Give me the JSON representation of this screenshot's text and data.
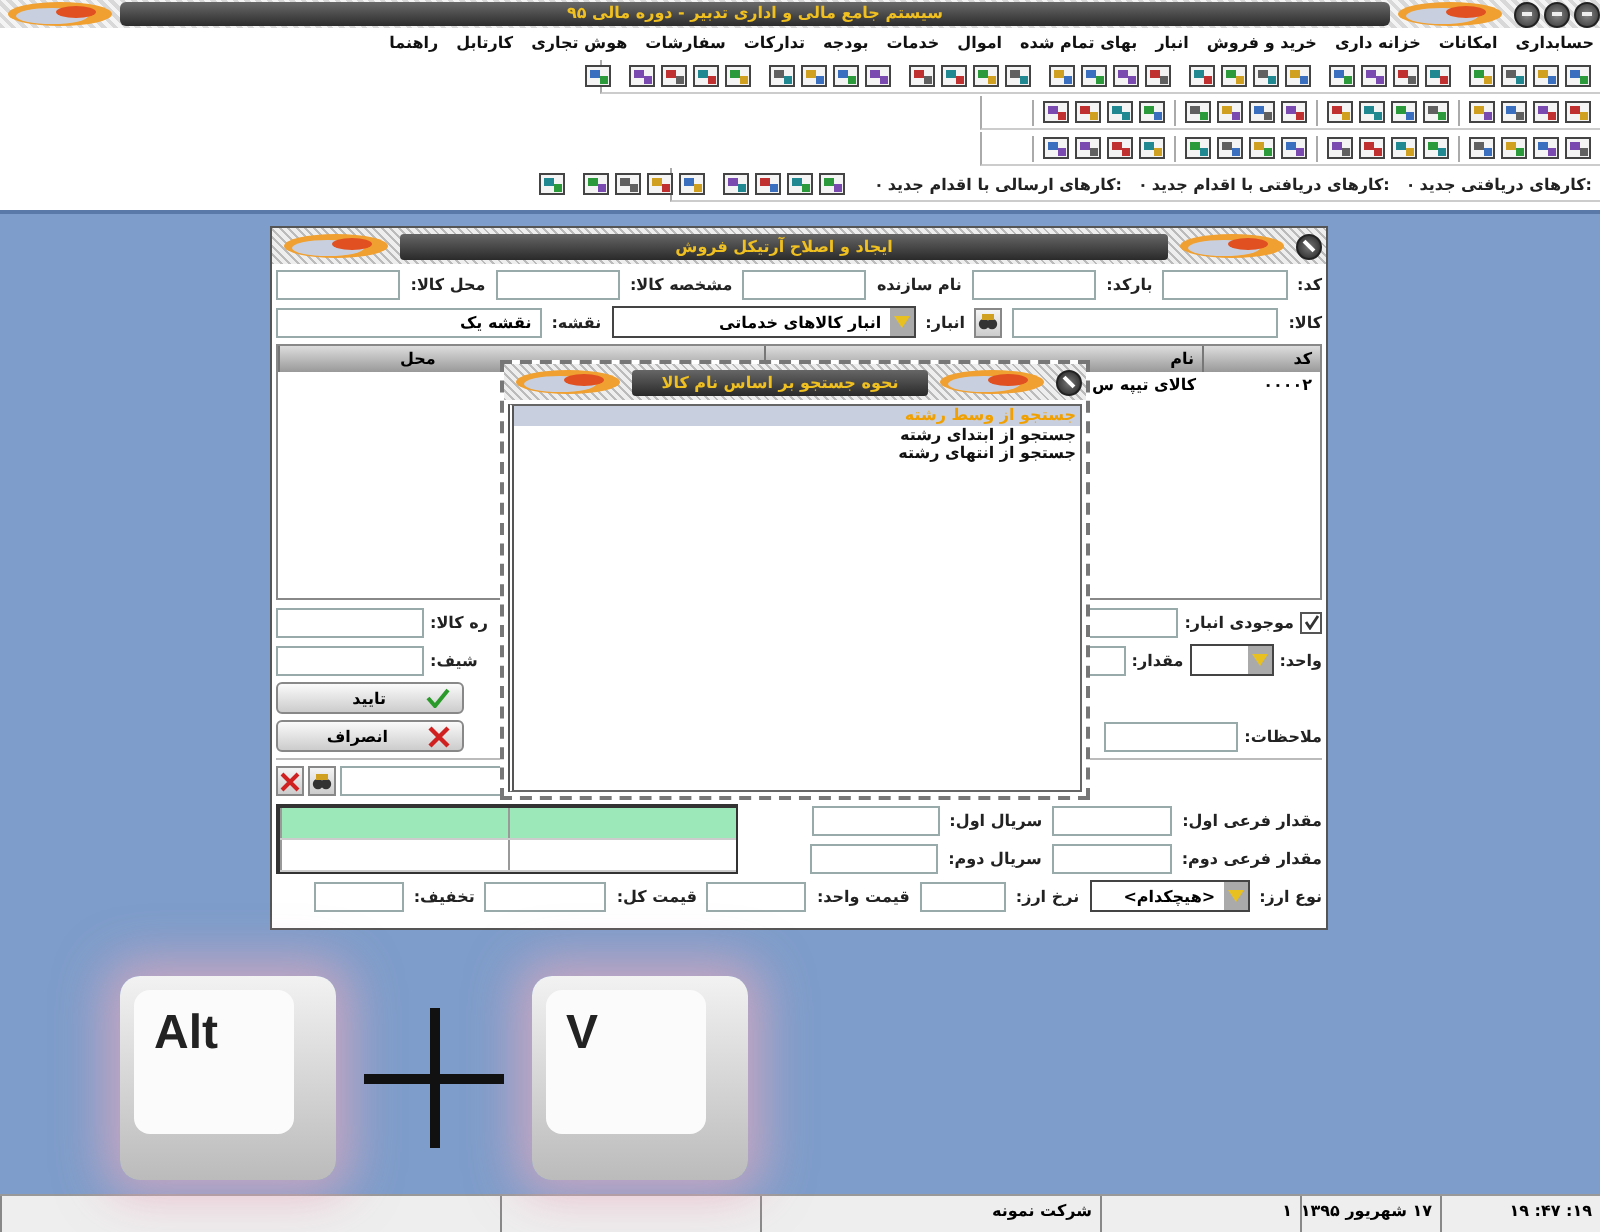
{
  "window": {
    "title": "سیستم جامع مالی و اداری تدبیر - دوره مالی ۹۵"
  },
  "menu": [
    "حسابداری",
    "امکانات",
    "خزانه داری",
    "خرید و فروش",
    "انبار",
    "بهای تمام شده",
    "اموال",
    "خدمات",
    "بودجه",
    "تدارکات",
    "سفارشات",
    "هوش تجاری",
    "کارتابل",
    "راهنما"
  ],
  "task_counters": [
    {
      "label": "کارهای دریافتی جدید:",
      "count": "۰"
    },
    {
      "label": "کارهای دریافتی با اقدام جدید:",
      "count": "۰"
    },
    {
      "label": "کارهای ارسالی با اقدام جدید:",
      "count": "۰"
    }
  ],
  "form": {
    "title": "ایجاد و اصلاح آرتیکل فروش",
    "header_fields": [
      {
        "label": "کد:"
      },
      {
        "label": "بارکد:"
      },
      {
        "label": "نام سازنده"
      },
      {
        "label": "مشخصه کالا:"
      },
      {
        "label": "محل کالا:"
      }
    ],
    "item_field": {
      "label": "کالا:"
    },
    "warehouse": {
      "label": "انبار:",
      "value": "انبار کالاهای خدماتی"
    },
    "map": {
      "label": "نقشه:",
      "value": "نقشه یک"
    },
    "table": {
      "columns": [
        "کد",
        "نام",
        "محل"
      ],
      "rows": [
        [
          "۰۰۰۰۲",
          "کالای تیپه س"
        ]
      ]
    },
    "stock": {
      "label": "موجودی انبار:",
      "checked": true
    },
    "unit": {
      "label": "واحد:"
    },
    "quantity": {
      "label": "مقدار:"
    },
    "left_fields": [
      {
        "label": "ره کالا:"
      },
      {
        "label": "شیف:"
      }
    ],
    "buttons": [
      {
        "label": "تایید",
        "kind": "ok"
      },
      {
        "label": "انصراف",
        "kind": "cancel"
      }
    ],
    "notes": {
      "label": "ملاحظات:"
    },
    "sub_rows": [
      {
        "quantity_label": "مقدار فرعی اول:",
        "serial_label": "سریال اول:"
      },
      {
        "quantity_label": "مقدار فرعی دوم:",
        "serial_label": "سریال دوم:"
      }
    ],
    "grid_rows": [
      {
        "selected": true
      },
      {
        "selected": false
      }
    ],
    "currency": {
      "label": "نوع ارز:",
      "value": "<هیچکدام>"
    },
    "price_fields": [
      {
        "label": "نرخ ارز:"
      },
      {
        "label": "قیمت واحد:"
      },
      {
        "label": "قیمت کل:"
      },
      {
        "label": "تخفیف:"
      }
    ]
  },
  "dialog": {
    "title": "نحوه جستجو بر اساس نام کالا",
    "options": [
      {
        "label": "جستجو از وسط رشته",
        "selected": true
      },
      {
        "label": "جستجو از ابتدای رشته",
        "selected": false
      },
      {
        "label": "جستجو از انتهای رشته",
        "selected": false
      }
    ]
  },
  "shortcut_keys": [
    "V",
    "Alt"
  ],
  "status_bar": [
    "۱۹: ۴۷: ۱۹",
    "۱۷ شهریور ۱۳۹۵",
    "۱",
    "شرکت نمونه"
  ]
}
